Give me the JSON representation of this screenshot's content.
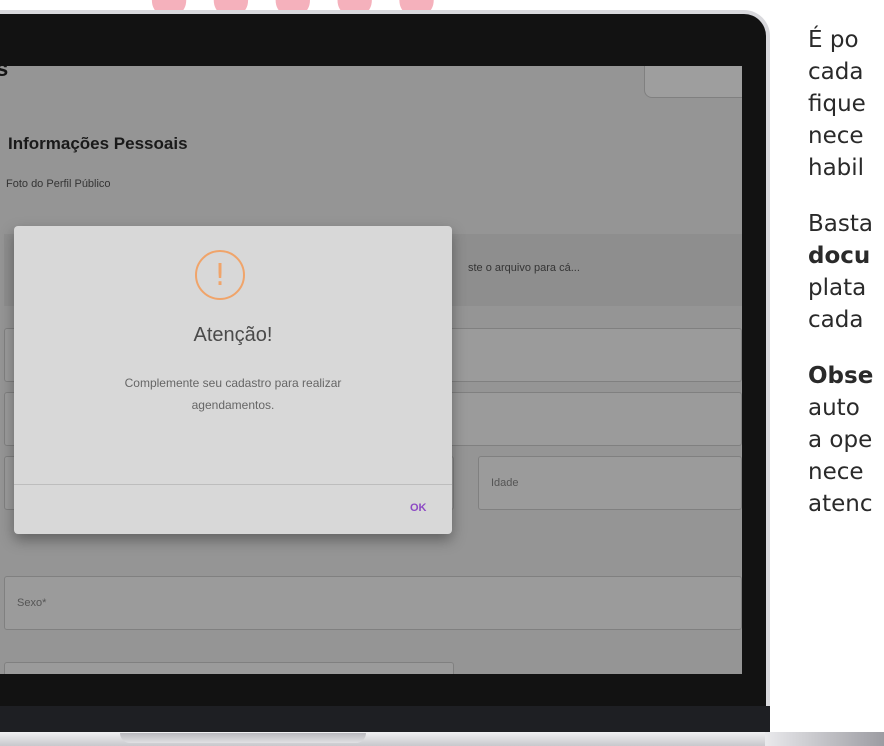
{
  "form": {
    "section_title": "Informações Pessoais",
    "photo_label": "Foto do Perfil Público",
    "dropzone_text": "ste o arquivo para cá...",
    "idade_placeholder": "Idade",
    "sexo_placeholder": "Sexo*",
    "partial_header": "s"
  },
  "dialog": {
    "title": "Atenção!",
    "message_line1": "Complemente seu cadastro para realizar",
    "message_line2": "agendamentos.",
    "ok_label": "OK",
    "icon": "exclamation-icon",
    "icon_color": "#f0a46a",
    "ok_color": "#8d4ac4"
  },
  "side_text": {
    "p1": [
      "É po",
      "cada",
      "fique",
      "nece",
      "habil"
    ],
    "p2_l1": "Basta",
    "p2_l2_bold": "docu",
    "p2_l3": "plata",
    "p2_l4": "cada",
    "p3_l1_bold": "Obse",
    "p3_rest": [
      "auto",
      "a ope",
      "nece",
      "atenc"
    ]
  }
}
